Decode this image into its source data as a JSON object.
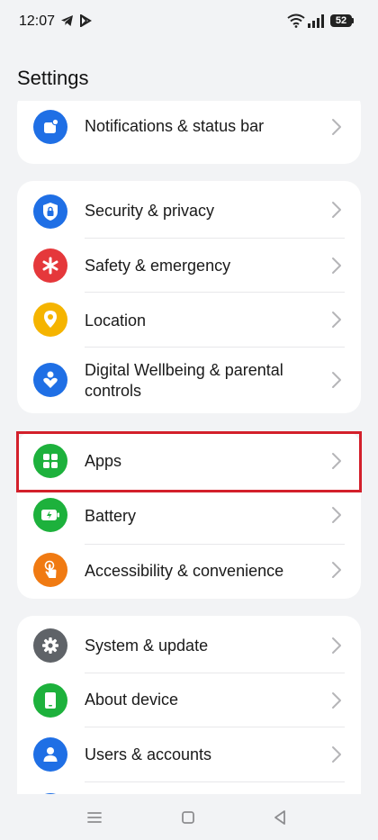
{
  "status": {
    "time": "12:07",
    "battery": "52"
  },
  "page": {
    "title": "Settings"
  },
  "groups": [
    {
      "items": [
        {
          "label": "Notifications & status bar",
          "icon": "notification-icon",
          "color": "#1f6fe5"
        }
      ]
    },
    {
      "items": [
        {
          "label": "Security & privacy",
          "icon": "shield-lock-icon",
          "color": "#1f6fe5"
        },
        {
          "label": "Safety & emergency",
          "icon": "asterisk-icon",
          "color": "#e5383b"
        },
        {
          "label": "Location",
          "icon": "location-pin-icon",
          "color": "#f5b400"
        },
        {
          "label": "Digital Wellbeing & parental controls",
          "icon": "wellbeing-icon",
          "color": "#1f6fe5"
        }
      ]
    },
    {
      "items": [
        {
          "label": "Apps",
          "icon": "apps-grid-icon",
          "color": "#1db13c"
        },
        {
          "label": "Battery",
          "icon": "battery-icon",
          "color": "#1db13c"
        },
        {
          "label": "Accessibility & convenience",
          "icon": "touch-hand-icon",
          "color": "#f07a12"
        }
      ]
    },
    {
      "items": [
        {
          "label": "System & update",
          "icon": "gear-icon",
          "color": "#5f6368"
        },
        {
          "label": "About device",
          "icon": "phone-icon",
          "color": "#1db13c"
        },
        {
          "label": "Users & accounts",
          "icon": "user-icon",
          "color": "#1f6fe5"
        }
      ]
    }
  ],
  "highlight_color": "#d3202b"
}
